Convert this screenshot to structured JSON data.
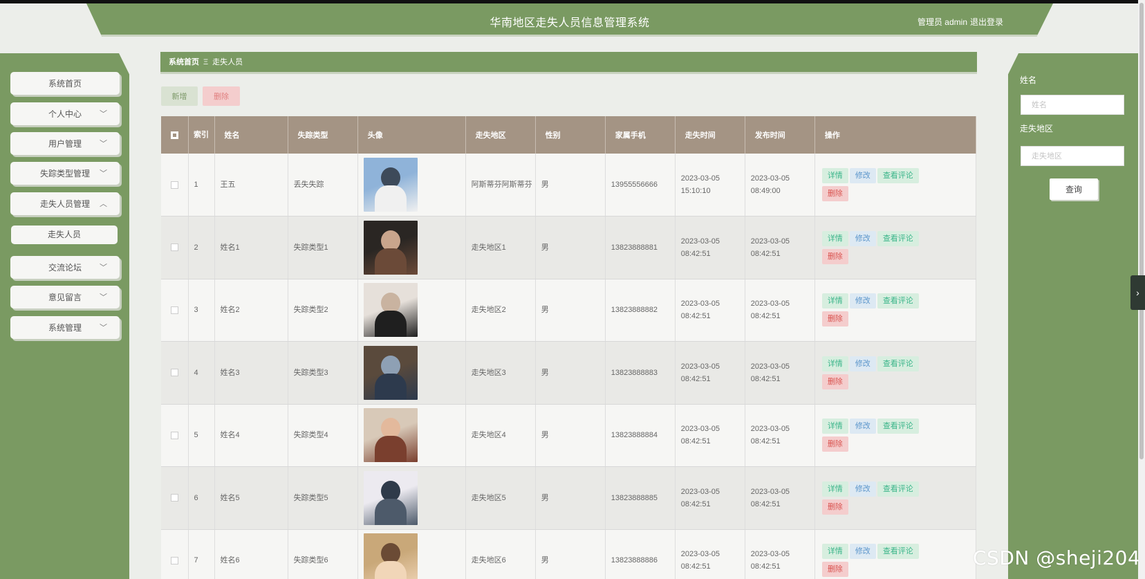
{
  "header": {
    "title": "华南地区走失人员信息管理系统",
    "user_label": "管理员 admin",
    "logout_label": "退出登录"
  },
  "sidebar": {
    "items": [
      {
        "label": "系统首页",
        "expandable": false
      },
      {
        "label": "个人中心",
        "expandable": true,
        "expanded": false
      },
      {
        "label": "用户管理",
        "expandable": true,
        "expanded": false
      },
      {
        "label": "失踪类型管理",
        "expandable": true,
        "expanded": false
      },
      {
        "label": "走失人员管理",
        "expandable": true,
        "expanded": true
      },
      {
        "label": "走失人员",
        "submenu": true
      },
      {
        "label": "交流论坛",
        "expandable": true,
        "expanded": false
      },
      {
        "label": "意见留言",
        "expandable": true,
        "expanded": false
      },
      {
        "label": "系统管理",
        "expandable": true,
        "expanded": false
      }
    ]
  },
  "breadcrumb": {
    "home": "系统首页",
    "separator": "Ξ",
    "current": "走失人员"
  },
  "toolbar": {
    "add_label": "新增",
    "delete_label": "删除"
  },
  "search": {
    "name_label": "姓名",
    "name_placeholder": "姓名",
    "area_label": "走失地区",
    "area_placeholder": "走失地区",
    "query_label": "查询"
  },
  "table": {
    "headers": {
      "index": "索引",
      "name": "姓名",
      "type": "失踪类型",
      "avatar": "头像",
      "area": "走失地区",
      "gender": "性别",
      "phone": "家属手机",
      "lost_time": "走失时间",
      "publish_time": "发布时间",
      "actions": "操作"
    },
    "action_labels": {
      "detail": "详情",
      "edit": "修改",
      "comments": "查看评论",
      "delete": "删除"
    },
    "rows": [
      {
        "index": "1",
        "name": "王五",
        "type": "丢失失踪",
        "area": "阿斯蒂芬阿斯蒂芬",
        "gender": "男",
        "phone": "13955556666",
        "lost_time": "2023-03-05 15:10:10",
        "publish_time": "2023-03-05 08:49:00"
      },
      {
        "index": "2",
        "name": "姓名1",
        "type": "失踪类型1",
        "area": "走失地区1",
        "gender": "男",
        "phone": "13823888881",
        "lost_time": "2023-03-05 08:42:51",
        "publish_time": "2023-03-05 08:42:51"
      },
      {
        "index": "3",
        "name": "姓名2",
        "type": "失踪类型2",
        "area": "走失地区2",
        "gender": "男",
        "phone": "13823888882",
        "lost_time": "2023-03-05 08:42:51",
        "publish_time": "2023-03-05 08:42:51"
      },
      {
        "index": "4",
        "name": "姓名3",
        "type": "失踪类型3",
        "area": "走失地区3",
        "gender": "男",
        "phone": "13823888883",
        "lost_time": "2023-03-05 08:42:51",
        "publish_time": "2023-03-05 08:42:51"
      },
      {
        "index": "5",
        "name": "姓名4",
        "type": "失踪类型4",
        "area": "走失地区4",
        "gender": "男",
        "phone": "13823888884",
        "lost_time": "2023-03-05 08:42:51",
        "publish_time": "2023-03-05 08:42:51"
      },
      {
        "index": "6",
        "name": "姓名5",
        "type": "失踪类型5",
        "area": "走失地区5",
        "gender": "男",
        "phone": "13823888885",
        "lost_time": "2023-03-05 08:42:51",
        "publish_time": "2023-03-05 08:42:51"
      },
      {
        "index": "7",
        "name": "姓名6",
        "type": "失踪类型6",
        "area": "走失地区6",
        "gender": "男",
        "phone": "13823888886",
        "lost_time": "2023-03-05 08:42:51",
        "publish_time": "2023-03-05 08:42:51"
      }
    ]
  },
  "watermark": "CSDN @sheji204",
  "colors": {
    "accent": "#7a9a62",
    "table_header": "#a49484",
    "detail_text": "#3bb58a",
    "edit_text": "#5a95cb",
    "delete_text": "#d9534f"
  }
}
